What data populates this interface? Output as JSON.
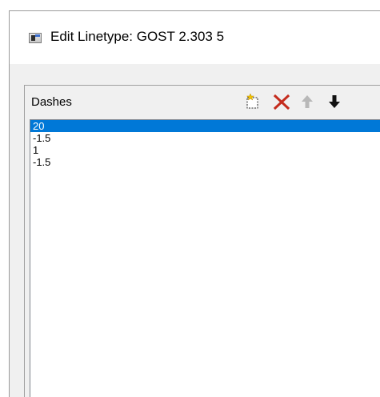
{
  "window": {
    "title": "Edit Linetype: GOST 2.303 5"
  },
  "dashes": {
    "label": "Dashes",
    "toolbar": {
      "icons": [
        "new-icon",
        "delete-icon",
        "move-up-icon",
        "move-down-icon"
      ]
    },
    "items": [
      "20",
      "-1.5",
      "1",
      "-1.5"
    ],
    "selected_index": 0
  },
  "colors": {
    "selection": "#0078d7",
    "delete": "#c42b1c"
  }
}
